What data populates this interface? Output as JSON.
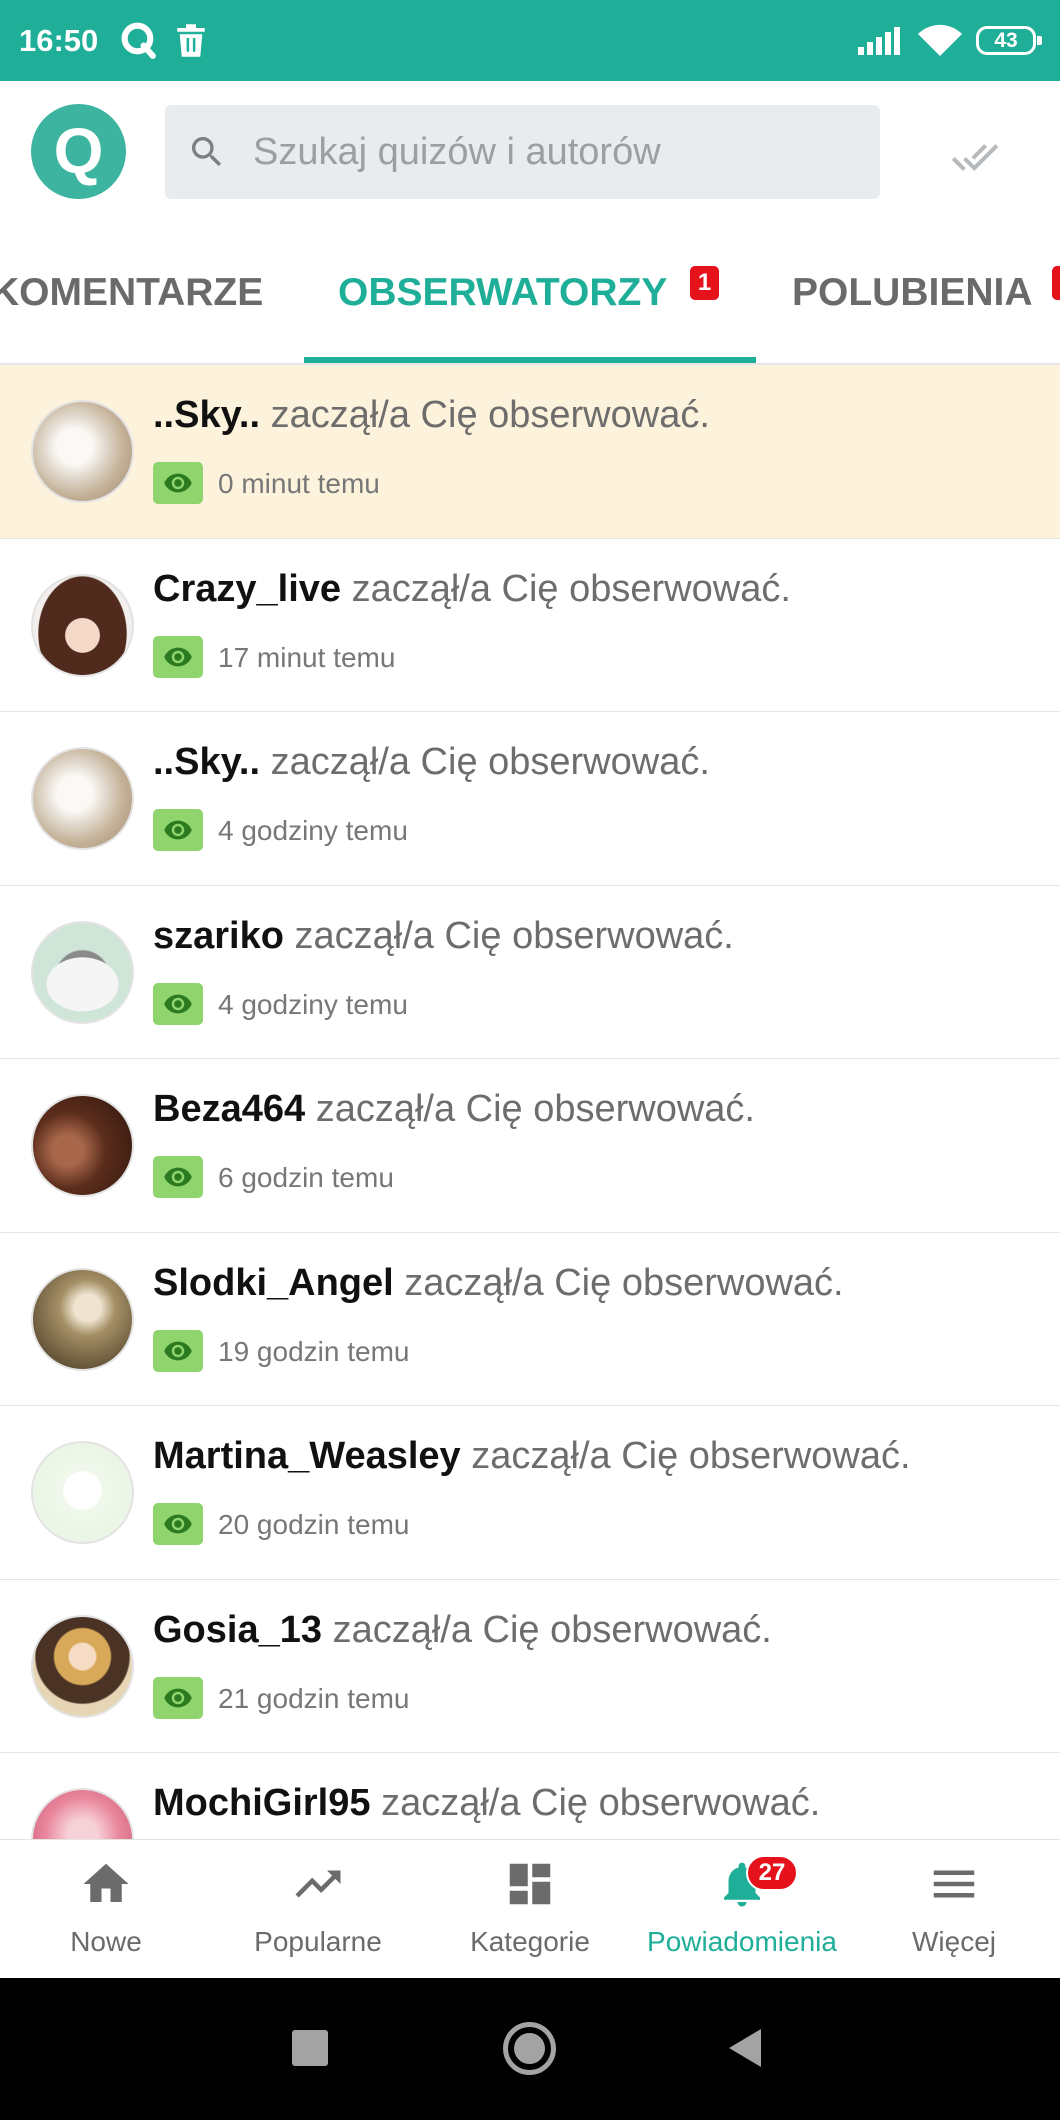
{
  "status_bar": {
    "time": "16:50",
    "battery": "43"
  },
  "header": {
    "logo_letter": "Q",
    "search": {
      "placeholder": "Szukaj quizów i autorów"
    }
  },
  "tabs": [
    {
      "label": "KOMENTARZE",
      "active": false
    },
    {
      "label": "OBSERWATORZY",
      "badge": "1",
      "active": true
    },
    {
      "label": "POLUBIENIA",
      "active": false
    }
  ],
  "notifications": [
    {
      "user": "..Sky..",
      "action": "zaczął/a Cię obserwować.",
      "time": "0 minut temu",
      "unread": true
    },
    {
      "user": "Crazy_live",
      "action": "zaczął/a Cię obserwować.",
      "time": "17 minut temu",
      "unread": false
    },
    {
      "user": "..Sky..",
      "action": "zaczął/a Cię obserwować.",
      "time": "4 godziny temu",
      "unread": false
    },
    {
      "user": "szariko",
      "action": "zaczął/a Cię obserwować.",
      "time": "4 godziny temu",
      "unread": false
    },
    {
      "user": "Beza464",
      "action": "zaczął/a Cię obserwować.",
      "time": "6 godzin temu",
      "unread": false
    },
    {
      "user": "Slodki_Angel",
      "action": "zaczął/a Cię obserwować.",
      "time": "19 godzin temu",
      "unread": false
    },
    {
      "user": "Martina_Weasley",
      "action": "zaczął/a Cię obserwować.",
      "time": "20 godzin temu",
      "unread": false
    },
    {
      "user": "Gosia_13",
      "action": "zaczął/a Cię obserwować.",
      "time": "21 godzin temu",
      "unread": false
    },
    {
      "user": "MochiGirl95",
      "action": "zaczął/a Cię obserwować.",
      "unread": false
    }
  ],
  "bottom_nav": [
    {
      "label": "Nowe",
      "icon": "home-icon",
      "active": false
    },
    {
      "label": "Popularne",
      "icon": "trending-up-icon",
      "active": false
    },
    {
      "label": "Kategorie",
      "icon": "dashboard-icon",
      "active": false
    },
    {
      "label": "Powiadomienia",
      "icon": "bell-icon",
      "active": true,
      "badge": "27"
    },
    {
      "label": "Więcej",
      "icon": "menu-icon",
      "active": false
    }
  ],
  "colors": {
    "accent": "#1fae98",
    "unread_bg": "#fdf2db",
    "badge_red": "#e5121c",
    "seen_green": "#8fd46c"
  }
}
